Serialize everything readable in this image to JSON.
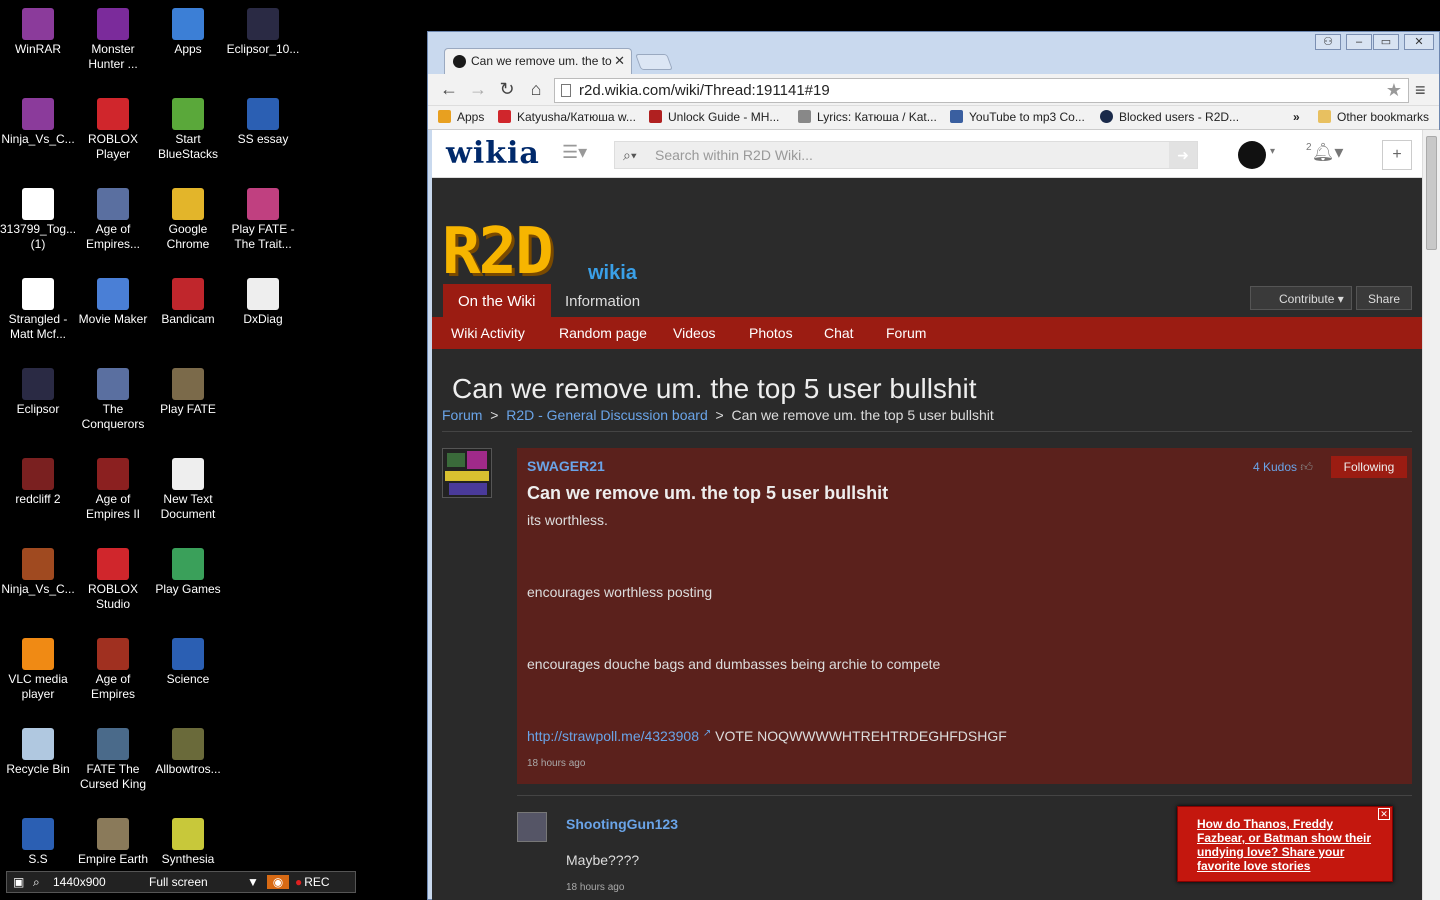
{
  "desktop": {
    "icons": [
      {
        "label": "WinRAR",
        "color": "#8b3b9b"
      },
      {
        "label": "Monster Hunter ...",
        "color": "#7b2b9b"
      },
      {
        "label": "Apps",
        "color": "#3c7fd6"
      },
      {
        "label": "Eclipsor_10...",
        "color": "#2a2a44"
      },
      {
        "label": "Ninja_Vs_C...",
        "color": "#8b3b9b"
      },
      {
        "label": "ROBLOX Player",
        "color": "#d0262c"
      },
      {
        "label": "Start BlueStacks",
        "color": "#5aa83a"
      },
      {
        "label": "SS essay",
        "color": "#2b5fb3"
      },
      {
        "label": "313799_Tog... (1)",
        "color": "#ffffff"
      },
      {
        "label": "Age of Empires...",
        "color": "#5a6fa0"
      },
      {
        "label": "Google Chrome",
        "color": "#e3b52a"
      },
      {
        "label": "Play FATE - The Trait...",
        "color": "#c04080"
      },
      {
        "label": "Strangled - Matt Mcf...",
        "color": "#ffffff"
      },
      {
        "label": "Movie Maker",
        "color": "#4a7fd6"
      },
      {
        "label": "Bandicam",
        "color": "#c0262c"
      },
      {
        "label": "DxDiag",
        "color": "#eeeeee"
      },
      {
        "label": "Eclipsor",
        "color": "#2a2a44"
      },
      {
        "label": "The Conquerors",
        "color": "#5a6fa0"
      },
      {
        "label": "Play FATE",
        "color": "#7b6a4a"
      },
      {
        "label": "redcliff 2",
        "color": "#7a2020"
      },
      {
        "label": "Age of Empires II",
        "color": "#8b2020"
      },
      {
        "label": "New Text Document",
        "color": "#eeeeee"
      },
      {
        "label": "Ninja_Vs_C...",
        "color": "#a04a20"
      },
      {
        "label": "ROBLOX Studio",
        "color": "#d0262c"
      },
      {
        "label": "Play Games",
        "color": "#3aa05a"
      },
      {
        "label": "VLC media player",
        "color": "#f08a14"
      },
      {
        "label": "Age of Empires",
        "color": "#a03020"
      },
      {
        "label": "Science",
        "color": "#2b5fb3"
      },
      {
        "label": "Recycle Bin",
        "color": "#b0c8e0"
      },
      {
        "label": "FATE The Cursed King",
        "color": "#4a6a8a"
      },
      {
        "label": "Allbowtros...",
        "color": "#6a6a3a"
      },
      {
        "label": "S.S",
        "color": "#2b5fb3"
      },
      {
        "label": "Empire Earth",
        "color": "#8a7a5a"
      },
      {
        "label": "Synthesia",
        "color": "#c8c83a"
      }
    ]
  },
  "recorder": {
    "resolution": "1440x900",
    "mode": "Full screen",
    "rec_label": "REC"
  },
  "browser": {
    "tab_title": "Can we remove um. the to",
    "url": "r2d.wikia.com/wiki/Thread:191141#19",
    "bookmarks": [
      {
        "label": "Apps",
        "color": "#e8a020"
      },
      {
        "label": "Katyusha/Катюша w...",
        "color": "#d0262c"
      },
      {
        "label": "Unlock Guide - MH...",
        "color": "#b02020"
      },
      {
        "label": "Lyrics: Катюша / Kat...",
        "color": "#888888"
      },
      {
        "label": "YouTube to mp3 Co...",
        "color": "#3a5fa0"
      },
      {
        "label": "Blocked users - R2D...",
        "color": "#1a2a4a"
      }
    ],
    "more_bookmarks": "»",
    "other_bookmarks": "Other bookmarks"
  },
  "wikia": {
    "logo": "wikia",
    "search_placeholder": "Search within R2D Wiki...",
    "notif_count": "2",
    "wiki_logo": "R2D",
    "wiki_logo_sub": "wikia",
    "tabs": [
      "On the Wiki",
      "Information"
    ],
    "contribute": "Contribute",
    "share": "Share",
    "localnav": [
      "Wiki Activity",
      "Random page",
      "Videos",
      "Photos",
      "Chat",
      "Forum"
    ]
  },
  "thread": {
    "title": "Can we remove um. the top 5 user bullshit",
    "breadcrumbs": [
      "Forum",
      "R2D - General Discussion board",
      "Can we remove um. the top 5 user bullshit"
    ],
    "post": {
      "author": "SWAGER21",
      "kudos": "4 Kudos",
      "following": "Following",
      "title": "Can we remove um. the top 5 user bullshit",
      "lines": [
        "its worthless.",
        "encourages worthless posting",
        "encourages douche bags and dumbasses being archie to compete"
      ],
      "link": "http://strawpoll.me/4323908",
      "link_suffix": "VOTE NOQWWWWHTREHTRDEGHFDSHGF",
      "time": "18 hours ago"
    },
    "reply": {
      "author": "ShootingGun123",
      "text": "Maybe????",
      "time": "18 hours ago"
    }
  },
  "popup": {
    "text": "How do Thanos, Freddy Fazbear, or Batman show their undying love? Share your favorite love stories"
  }
}
